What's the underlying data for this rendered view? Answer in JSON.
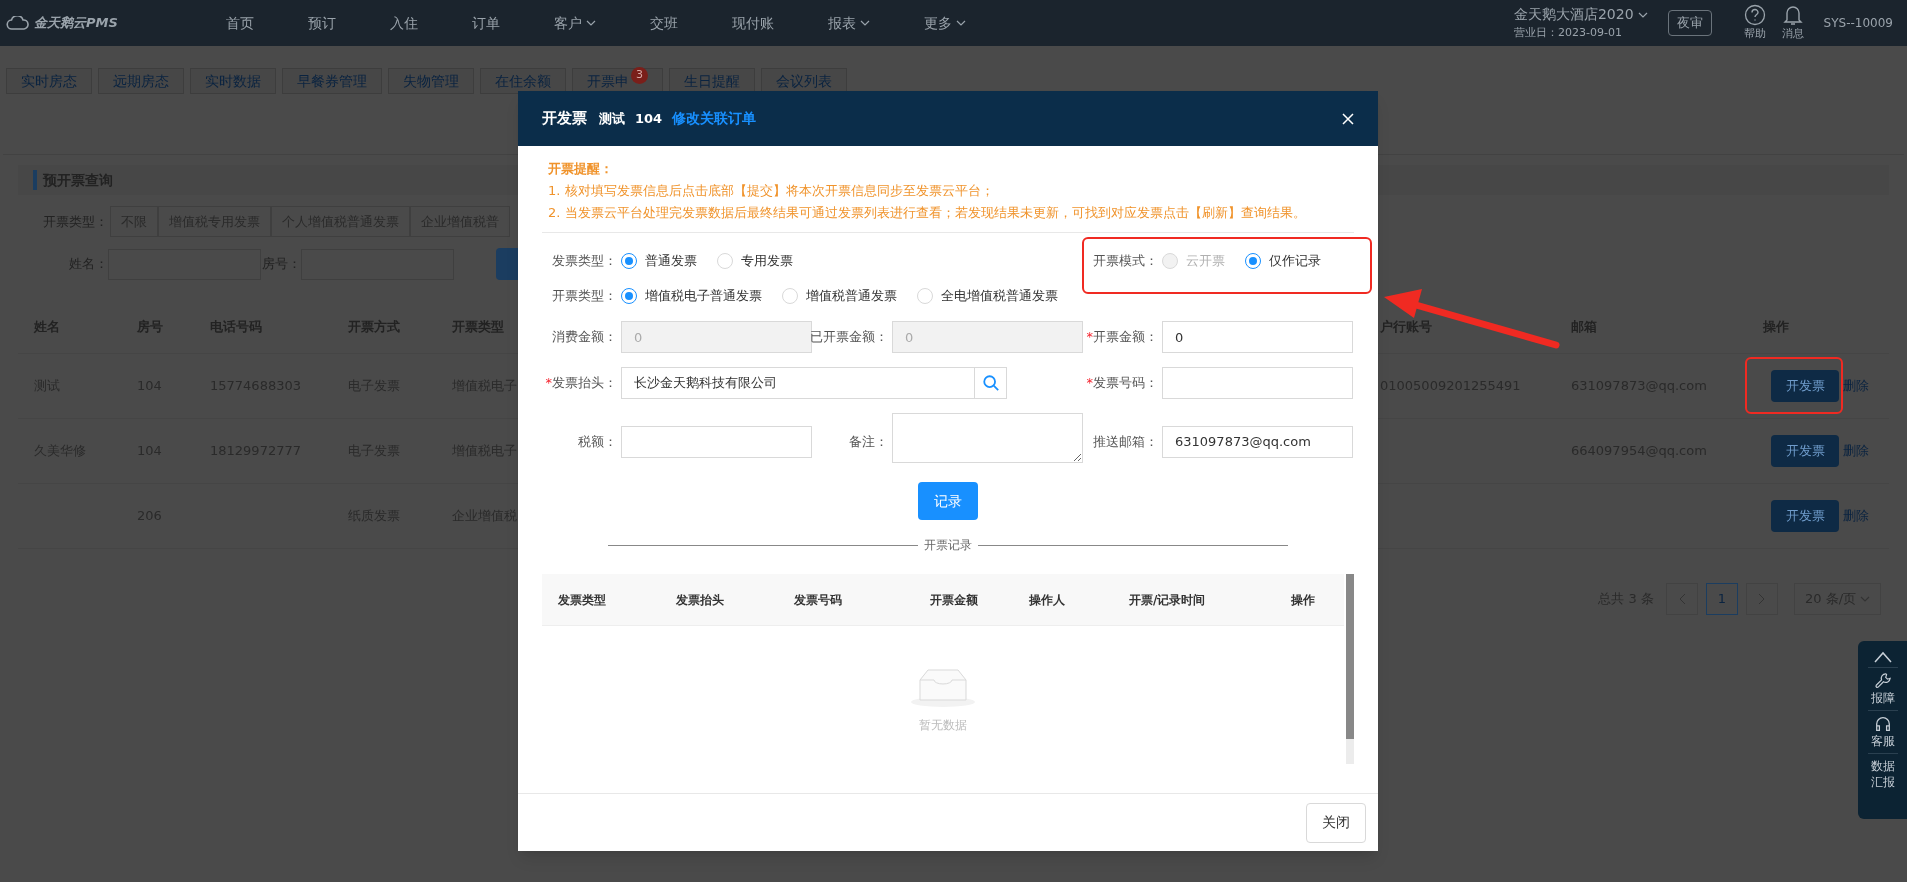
{
  "top_nav": {
    "logo": "金天鹅云PMS",
    "menu": [
      {
        "label": "首页",
        "dropdown": false
      },
      {
        "label": "预订",
        "dropdown": false
      },
      {
        "label": "入住",
        "dropdown": false
      },
      {
        "label": "订单",
        "dropdown": false
      },
      {
        "label": "客户",
        "dropdown": true
      },
      {
        "label": "交班",
        "dropdown": false
      },
      {
        "label": "现付账",
        "dropdown": false
      },
      {
        "label": "报表",
        "dropdown": true
      },
      {
        "label": "更多",
        "dropdown": true
      }
    ],
    "hotel": "金天鹅大酒店2020",
    "business_date": "营业日：2023-09-01",
    "night_audit": "夜审",
    "help": "帮助",
    "messages": "消息",
    "user": "SYS--10009"
  },
  "tabs": [
    {
      "label": "实时房态"
    },
    {
      "label": "远期房态"
    },
    {
      "label": "实时数据"
    },
    {
      "label": "早餐券管理"
    },
    {
      "label": "失物管理"
    },
    {
      "label": "在住余额"
    },
    {
      "label": "开票申",
      "badge": "3"
    },
    {
      "label": "生日提醒"
    },
    {
      "label": "会议列表"
    }
  ],
  "section": {
    "title": "预开票查询",
    "filter_label": "开票类型：",
    "filter_options": [
      "不限",
      "增值税专用发票",
      "个人增值税普通发票",
      "企业增值税普"
    ],
    "name_label": "姓名：",
    "room_label": "房号："
  },
  "table": {
    "columns": [
      "姓名",
      "房号",
      "电话号码",
      "开票方式",
      "开票类型",
      "户行账号",
      "邮箱",
      "操作"
    ],
    "rows": [
      {
        "name": "测试",
        "room": "104",
        "phone": "15774688303",
        "method": "电子发票",
        "type": "增值税电子",
        "account": "01005009201255491",
        "email": "631097873@qq.com",
        "actions": [
          "开发票",
          "删除"
        ],
        "highlighted": true
      },
      {
        "name": "久美华修",
        "room": "104",
        "phone": "18129972777",
        "method": "电子发票",
        "type": "增值税电子",
        "email": "664097954@qq.com",
        "actions": [
          "开发票",
          "删除"
        ],
        "highlighted": false
      },
      {
        "room": "206",
        "method": "纸质发票",
        "type": "企业增值税",
        "actions": [
          "开发票",
          "删除"
        ],
        "highlighted": false
      }
    ]
  },
  "pagination": {
    "total": "总共 3 条",
    "page": "1",
    "page_size": "20 条/页"
  },
  "float_panel": [
    {
      "kind": "up"
    },
    {
      "kind": "wrench",
      "label": "报障"
    },
    {
      "kind": "headset",
      "label": "客服"
    },
    {
      "kind": "text",
      "label": "数据汇报"
    }
  ],
  "modal": {
    "title": "开发票",
    "guest": "测试",
    "room": "104",
    "link": "修改关联订单",
    "notice": {
      "title": "开票提醒：",
      "lines": [
        "1. 核对填写发票信息后点击底部【提交】将本次开票信息同步至发票云平台；",
        "2. 当发票云平台处理完发票数据后最终结果可通过发票列表进行查看；若发现结果未更新，可找到对应发票点击【刷新】查询结果。"
      ]
    },
    "invoice_type": {
      "label": "发票类型：",
      "options": [
        {
          "label": "普通发票",
          "selected": true,
          "disabled": false
        },
        {
          "label": "专用发票",
          "selected": false,
          "disabled": false
        }
      ]
    },
    "mode": {
      "label": "开票模式：",
      "highlighted": true,
      "options": [
        {
          "label": "云开票",
          "selected": false,
          "disabled": true
        },
        {
          "label": "仅作记录",
          "selected": true,
          "disabled": false
        }
      ]
    },
    "issue_type": {
      "label": "开票类型：",
      "options": [
        {
          "label": "增值税电子普通发票",
          "selected": true,
          "disabled": false
        },
        {
          "label": "增值税普通发票",
          "selected": false,
          "disabled": false
        },
        {
          "label": "全电增值税普通发票",
          "selected": false,
          "disabled": false
        }
      ]
    },
    "fields": [
      {
        "kind": "text",
        "label": "消费金额：",
        "value": "0",
        "disabled": true
      },
      {
        "kind": "text",
        "label": "已开票金额：",
        "value": "0",
        "disabled": true
      },
      {
        "kind": "text",
        "mark": "*",
        "label": "开票金额：",
        "value": "0",
        "disabled": false
      },
      {
        "kind": "search",
        "mark": "*",
        "label": "发票抬头：",
        "value": "长沙金天鹅科技有限公司",
        "disabled": false
      },
      {
        "kind": "text",
        "mark": "*",
        "label": "发票号码：",
        "disabled": false
      },
      {
        "kind": "text",
        "label": "税额：",
        "disabled": false
      },
      {
        "kind": "textarea",
        "label": "备注：",
        "disabled": false
      },
      {
        "kind": "text",
        "label": "推送邮箱：",
        "value": "631097873@qq.com",
        "disabled": false
      }
    ],
    "record_button": "记录",
    "records": {
      "title": "开票记录",
      "columns": [
        "发票类型",
        "发票抬头",
        "发票号码",
        "开票金额",
        "操作人",
        "开票/记录时间",
        "操作"
      ],
      "empty": "暂无数据"
    },
    "close_button": "关闭"
  }
}
